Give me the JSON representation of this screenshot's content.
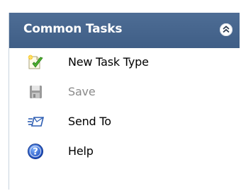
{
  "panel": {
    "title": "Common Tasks",
    "collapse_icon": "double-chevron-up-icon",
    "colors": {
      "header_bg": "#46658e",
      "header_text": "#ffffff",
      "item_text": "#000000",
      "disabled_text": "#8a8a8a"
    },
    "items": [
      {
        "label": "New Task Type",
        "icon": "new-document-check-icon",
        "enabled": true
      },
      {
        "label": "Save",
        "icon": "save-floppy-icon",
        "enabled": false
      },
      {
        "label": "Send To",
        "icon": "send-to-icon",
        "enabled": true
      },
      {
        "label": "Help",
        "icon": "help-icon",
        "enabled": true
      }
    ]
  }
}
